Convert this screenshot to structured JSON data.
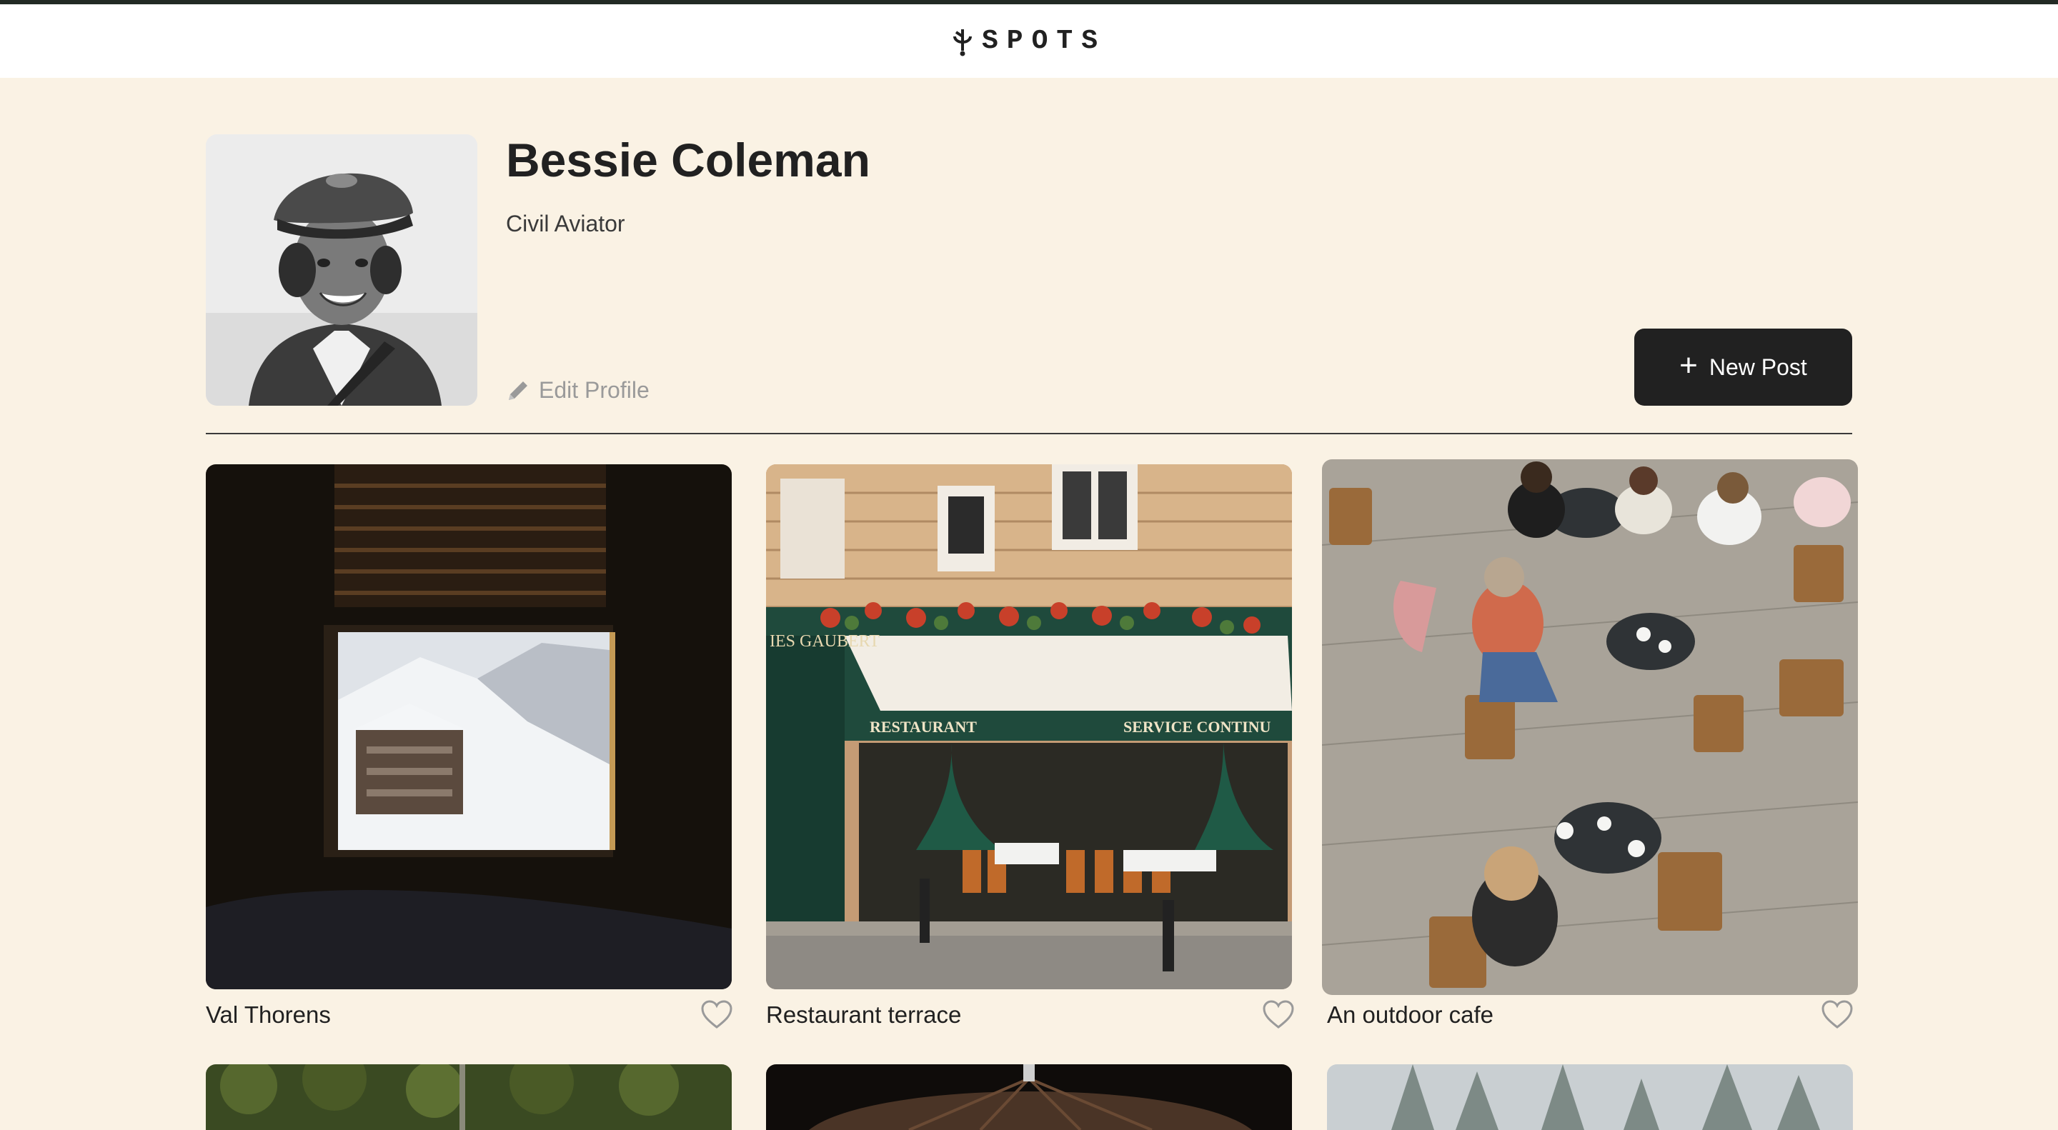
{
  "header": {
    "logo_text": "SPOTS",
    "logo_icon": "sprout-icon"
  },
  "profile": {
    "name": "Bessie Coleman",
    "title": "Civil Aviator",
    "edit_label": "Edit Profile",
    "edit_icon": "pencil-icon"
  },
  "actions": {
    "new_post_label": "New Post",
    "new_post_icon": "plus-icon"
  },
  "cards": [
    {
      "caption": "Val Thorens",
      "liked": false
    },
    {
      "caption": "Restaurant terrace",
      "liked": false
    },
    {
      "caption": "An outdoor cafe",
      "liked": false
    }
  ],
  "colors": {
    "page_background": "#faf2e4",
    "header_background": "#ffffff",
    "top_bar": "#222a24",
    "button_background": "#212121",
    "text_primary": "#212121",
    "text_muted": "#9a9a9a"
  }
}
